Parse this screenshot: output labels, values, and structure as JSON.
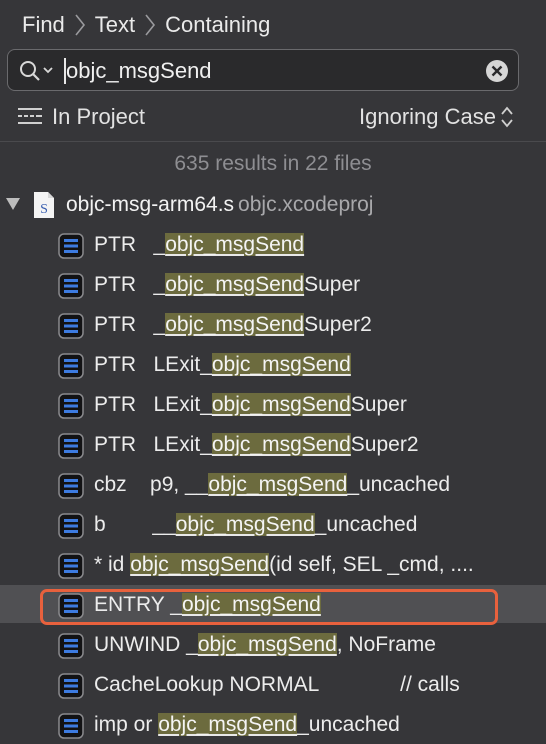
{
  "breadcrumb": {
    "items": [
      "Find",
      "Text",
      "Containing"
    ]
  },
  "search": {
    "value": "objc_msgSend",
    "icon": "search-icon"
  },
  "options": {
    "scope": "In Project",
    "case": "Ignoring Case"
  },
  "summary": "635 results in 22 files",
  "file": {
    "name": "objc-msg-arm64.s",
    "project": "objc.xcodeproj"
  },
  "results": [
    {
      "pre": "PTR   _",
      "match": "objc_msgSend",
      "post": ""
    },
    {
      "pre": "PTR   _",
      "match": "objc_msgSend",
      "post": "Super"
    },
    {
      "pre": "PTR   _",
      "match": "objc_msgSend",
      "post": "Super2"
    },
    {
      "pre": "PTR   LExit_",
      "match": "objc_msgSend",
      "post": ""
    },
    {
      "pre": "PTR   LExit_",
      "match": "objc_msgSend",
      "post": "Super"
    },
    {
      "pre": "PTR   LExit_",
      "match": "objc_msgSend",
      "post": "Super2"
    },
    {
      "pre": "cbz    p9, __",
      "match": "objc_msgSend",
      "post": "_uncached"
    },
    {
      "pre": "b        __",
      "match": "objc_msgSend",
      "post": "_uncached"
    },
    {
      "pre": "* id ",
      "match": "objc_msgSend",
      "post": "(id self, SEL _cmd, ...."
    },
    {
      "pre": "ENTRY _",
      "match": "objc_msgSend",
      "post": ""
    },
    {
      "pre": "UNWIND _",
      "match": "objc_msgSend",
      "post": ", NoFrame"
    },
    {
      "pre": "CacheLookup NORMAL              // calls",
      "match": "",
      "post": ""
    },
    {
      "pre": "imp or ",
      "match": "objc_msgSend",
      "post": "_uncached"
    }
  ],
  "selected_index": 9
}
